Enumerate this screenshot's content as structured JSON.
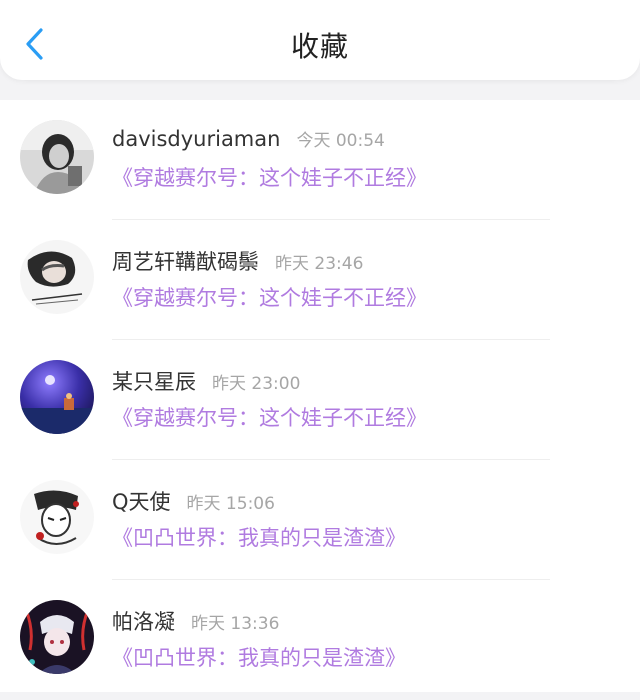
{
  "header": {
    "title": "收藏",
    "back_icon": "chevron-left-icon",
    "accent_color": "#2a9df4"
  },
  "items": [
    {
      "name": "davisdyuriaman",
      "time": "今天 00:54",
      "book": "《穿越赛尔号：这个娃子不正经》"
    },
    {
      "name": "周艺轩鞲猷碣鬃",
      "time": "昨天 23:46",
      "book": "《穿越赛尔号：这个娃子不正经》"
    },
    {
      "name": "某只星辰",
      "time": "昨天 23:00",
      "book": "《穿越赛尔号：这个娃子不正经》"
    },
    {
      "name": "Q天使",
      "time": "昨天 15:06",
      "book": "《凹凸世界：我真的只是渣渣》"
    },
    {
      "name": "帕洛凝",
      "time": "昨天 13:36",
      "book": "《凹凸世界：我真的只是渣渣》"
    }
  ],
  "colors": {
    "link": "#b07be0",
    "time": "#a6a6a6",
    "name": "#333333"
  }
}
